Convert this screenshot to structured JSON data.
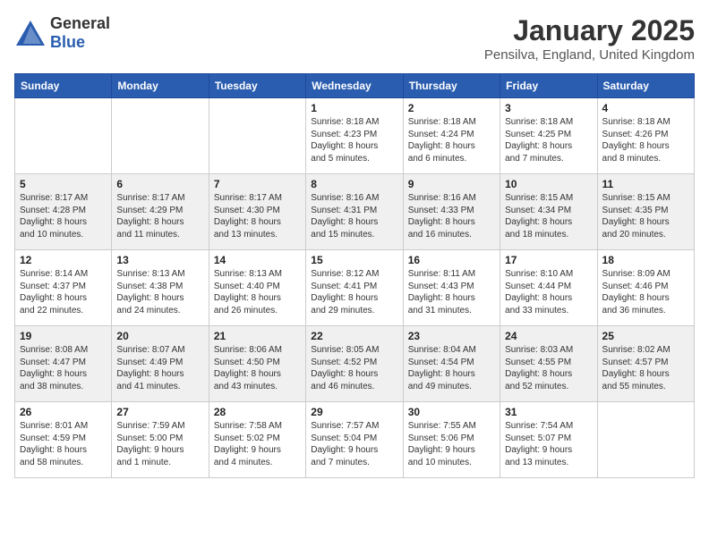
{
  "header": {
    "logo_general": "General",
    "logo_blue": "Blue",
    "month_title": "January 2025",
    "location": "Pensilva, England, United Kingdom"
  },
  "weekdays": [
    "Sunday",
    "Monday",
    "Tuesday",
    "Wednesday",
    "Thursday",
    "Friday",
    "Saturday"
  ],
  "weeks": [
    [
      {
        "day": "",
        "info": ""
      },
      {
        "day": "",
        "info": ""
      },
      {
        "day": "",
        "info": ""
      },
      {
        "day": "1",
        "info": "Sunrise: 8:18 AM\nSunset: 4:23 PM\nDaylight: 8 hours\nand 5 minutes."
      },
      {
        "day": "2",
        "info": "Sunrise: 8:18 AM\nSunset: 4:24 PM\nDaylight: 8 hours\nand 6 minutes."
      },
      {
        "day": "3",
        "info": "Sunrise: 8:18 AM\nSunset: 4:25 PM\nDaylight: 8 hours\nand 7 minutes."
      },
      {
        "day": "4",
        "info": "Sunrise: 8:18 AM\nSunset: 4:26 PM\nDaylight: 8 hours\nand 8 minutes."
      }
    ],
    [
      {
        "day": "5",
        "info": "Sunrise: 8:17 AM\nSunset: 4:28 PM\nDaylight: 8 hours\nand 10 minutes."
      },
      {
        "day": "6",
        "info": "Sunrise: 8:17 AM\nSunset: 4:29 PM\nDaylight: 8 hours\nand 11 minutes."
      },
      {
        "day": "7",
        "info": "Sunrise: 8:17 AM\nSunset: 4:30 PM\nDaylight: 8 hours\nand 13 minutes."
      },
      {
        "day": "8",
        "info": "Sunrise: 8:16 AM\nSunset: 4:31 PM\nDaylight: 8 hours\nand 15 minutes."
      },
      {
        "day": "9",
        "info": "Sunrise: 8:16 AM\nSunset: 4:33 PM\nDaylight: 8 hours\nand 16 minutes."
      },
      {
        "day": "10",
        "info": "Sunrise: 8:15 AM\nSunset: 4:34 PM\nDaylight: 8 hours\nand 18 minutes."
      },
      {
        "day": "11",
        "info": "Sunrise: 8:15 AM\nSunset: 4:35 PM\nDaylight: 8 hours\nand 20 minutes."
      }
    ],
    [
      {
        "day": "12",
        "info": "Sunrise: 8:14 AM\nSunset: 4:37 PM\nDaylight: 8 hours\nand 22 minutes."
      },
      {
        "day": "13",
        "info": "Sunrise: 8:13 AM\nSunset: 4:38 PM\nDaylight: 8 hours\nand 24 minutes."
      },
      {
        "day": "14",
        "info": "Sunrise: 8:13 AM\nSunset: 4:40 PM\nDaylight: 8 hours\nand 26 minutes."
      },
      {
        "day": "15",
        "info": "Sunrise: 8:12 AM\nSunset: 4:41 PM\nDaylight: 8 hours\nand 29 minutes."
      },
      {
        "day": "16",
        "info": "Sunrise: 8:11 AM\nSunset: 4:43 PM\nDaylight: 8 hours\nand 31 minutes."
      },
      {
        "day": "17",
        "info": "Sunrise: 8:10 AM\nSunset: 4:44 PM\nDaylight: 8 hours\nand 33 minutes."
      },
      {
        "day": "18",
        "info": "Sunrise: 8:09 AM\nSunset: 4:46 PM\nDaylight: 8 hours\nand 36 minutes."
      }
    ],
    [
      {
        "day": "19",
        "info": "Sunrise: 8:08 AM\nSunset: 4:47 PM\nDaylight: 8 hours\nand 38 minutes."
      },
      {
        "day": "20",
        "info": "Sunrise: 8:07 AM\nSunset: 4:49 PM\nDaylight: 8 hours\nand 41 minutes."
      },
      {
        "day": "21",
        "info": "Sunrise: 8:06 AM\nSunset: 4:50 PM\nDaylight: 8 hours\nand 43 minutes."
      },
      {
        "day": "22",
        "info": "Sunrise: 8:05 AM\nSunset: 4:52 PM\nDaylight: 8 hours\nand 46 minutes."
      },
      {
        "day": "23",
        "info": "Sunrise: 8:04 AM\nSunset: 4:54 PM\nDaylight: 8 hours\nand 49 minutes."
      },
      {
        "day": "24",
        "info": "Sunrise: 8:03 AM\nSunset: 4:55 PM\nDaylight: 8 hours\nand 52 minutes."
      },
      {
        "day": "25",
        "info": "Sunrise: 8:02 AM\nSunset: 4:57 PM\nDaylight: 8 hours\nand 55 minutes."
      }
    ],
    [
      {
        "day": "26",
        "info": "Sunrise: 8:01 AM\nSunset: 4:59 PM\nDaylight: 8 hours\nand 58 minutes."
      },
      {
        "day": "27",
        "info": "Sunrise: 7:59 AM\nSunset: 5:00 PM\nDaylight: 9 hours\nand 1 minute."
      },
      {
        "day": "28",
        "info": "Sunrise: 7:58 AM\nSunset: 5:02 PM\nDaylight: 9 hours\nand 4 minutes."
      },
      {
        "day": "29",
        "info": "Sunrise: 7:57 AM\nSunset: 5:04 PM\nDaylight: 9 hours\nand 7 minutes."
      },
      {
        "day": "30",
        "info": "Sunrise: 7:55 AM\nSunset: 5:06 PM\nDaylight: 9 hours\nand 10 minutes."
      },
      {
        "day": "31",
        "info": "Sunrise: 7:54 AM\nSunset: 5:07 PM\nDaylight: 9 hours\nand 13 minutes."
      },
      {
        "day": "",
        "info": ""
      }
    ]
  ]
}
